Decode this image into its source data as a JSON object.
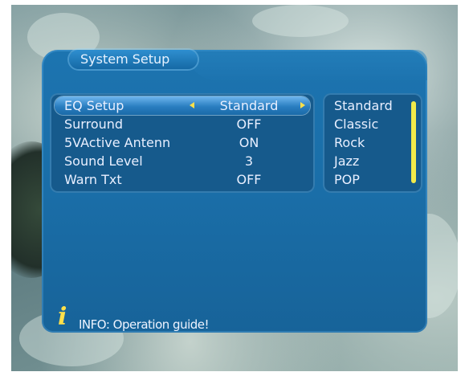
{
  "window": {
    "title": "System Setup"
  },
  "menu": {
    "items": [
      {
        "label": "EQ Setup",
        "value": "Standard",
        "selected": true
      },
      {
        "label": "Surround",
        "value": "OFF"
      },
      {
        "label": "5VActive Antenn",
        "value": "ON"
      },
      {
        "label": "Sound Level",
        "value": "3"
      },
      {
        "label": "Warn Txt",
        "value": "OFF"
      }
    ]
  },
  "options": {
    "items": [
      "Standard",
      "Classic",
      "Rock",
      "Jazz",
      "POP"
    ]
  },
  "info": {
    "icon": "info-i-icon",
    "glyph": "i",
    "text": "INFO: Operation guide!"
  },
  "colors": {
    "panel": "#1a6ea8",
    "highlight": "#2a7ec0",
    "accent": "#ffe04a",
    "text": "#e8efff"
  }
}
